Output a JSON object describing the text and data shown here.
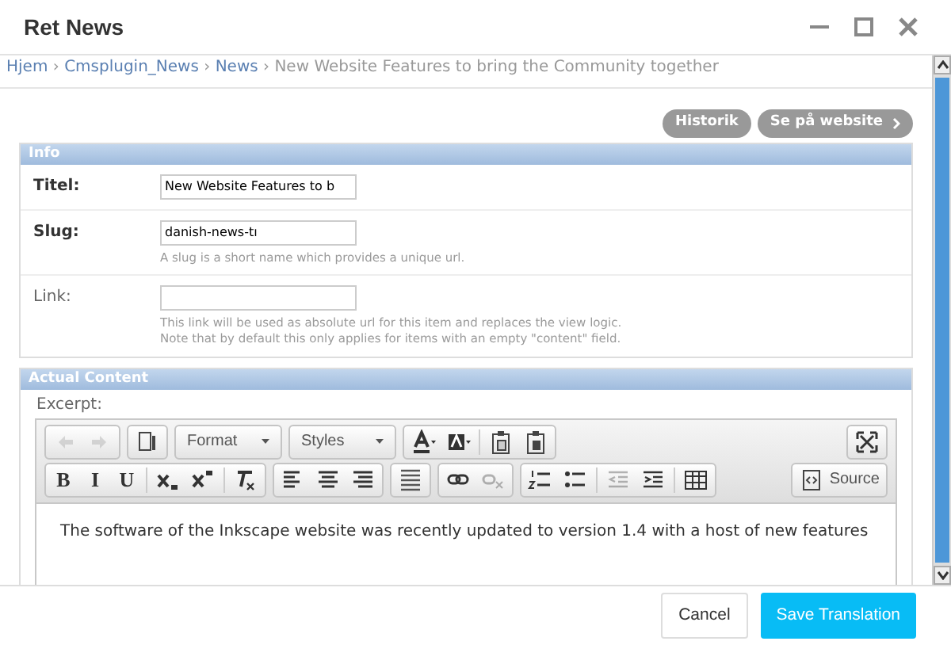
{
  "window": {
    "title": "Ret News"
  },
  "breadcrumb": [
    {
      "label": "Hjem",
      "link": true
    },
    {
      "label": "Cmsplugin_News",
      "link": true
    },
    {
      "label": "News",
      "link": true
    },
    {
      "label": "New Website Features to bring the Community together",
      "link": false
    }
  ],
  "breadcrumb_separator": "›",
  "object_tools": [
    {
      "label": "Historik",
      "arrow": false
    },
    {
      "label": "Se på website",
      "arrow": true
    }
  ],
  "fieldsets": [
    {
      "title": "Info",
      "fields": [
        {
          "label": "Titel:",
          "required": true,
          "value": "New Website Features to b"
        },
        {
          "label": "Slug:",
          "required": true,
          "value": "danish-news-tı",
          "help": [
            "A slug is a short name which provides a unique url."
          ]
        },
        {
          "label": "Link:",
          "required": false,
          "help": [
            "This link will be used as absolute url for this item and replaces the view logic.",
            "Note that by default this only applies for items with an empty \"content\" field."
          ]
        }
      ]
    },
    {
      "title": "Actual Content",
      "editor": {
        "label": "Excerpt:",
        "toolbar_rows": [
          {
            "groups": [
              [
                {
                  "kind": "icon",
                  "disabled": true
                },
                {
                  "kind": "icon",
                  "disabled": true
                }
              ],
              [
                {
                  "kind": "icon",
                  "disabled": false
                }
              ],
              [
                {
                  "kind": "dropdown",
                  "label": "Format",
                  "disabled": false
                }
              ],
              [
                {
                  "kind": "dropdown",
                  "label": "Styles",
                  "disabled": false
                }
              ],
              [
                {
                  "kind": "icon",
                  "disabled": false
                },
                {
                  "kind": "icon",
                  "disabled": false
                },
                {
                  "kind": "separator"
                },
                {
                  "kind": "icon",
                  "disabled": false
                },
                {
                  "kind": "icon",
                  "disabled": false
                }
              ]
            ],
            "right": [
              {
                "kind": "icon",
                "disabled": false
              }
            ]
          },
          {
            "groups": [
              [
                {
                  "kind": "text",
                  "label": "B",
                  "disabled": false
                },
                {
                  "kind": "text",
                  "label": "I",
                  "disabled": false
                },
                {
                  "kind": "text",
                  "label": "U",
                  "disabled": false
                },
                {
                  "kind": "separator"
                },
                {
                  "kind": "icon",
                  "disabled": false
                },
                {
                  "kind": "icon",
                  "disabled": false
                },
                {
                  "kind": "separator"
                },
                {
                  "kind": "icon",
                  "disabled": false
                }
              ],
              [
                {
                  "kind": "icon",
                  "disabled": false
                },
                {
                  "kind": "icon",
                  "disabled": false
                },
                {
                  "kind": "icon",
                  "disabled": false
                }
              ],
              [
                {
                  "kind": "icon",
                  "disabled": false
                }
              ],
              [
                {
                  "kind": "icon",
                  "disabled": false
                },
                {
                  "kind": "icon",
                  "disabled": true
                }
              ],
              [
                {
                  "kind": "icon",
                  "disabled": false
                },
                {
                  "kind": "icon",
                  "disabled": false
                },
                {
                  "kind": "separator"
                },
                {
                  "kind": "icon",
                  "disabled": true
                },
                {
                  "kind": "icon",
                  "disabled": false
                },
                {
                  "kind": "separator"
                },
                {
                  "kind": "icon",
                  "disabled": false
                }
              ]
            ],
            "right": [
              {
                "kind": "icon-text",
                "label": "Source",
                "disabled": false
              }
            ]
          }
        ],
        "content": "The software of the Inkscape website was recently updated to version 1.4 with a host of new features"
      }
    }
  ],
  "buttons": [
    {
      "label": "Cancel",
      "primary": false
    },
    {
      "label": "Save Translation",
      "primary": true
    }
  ]
}
